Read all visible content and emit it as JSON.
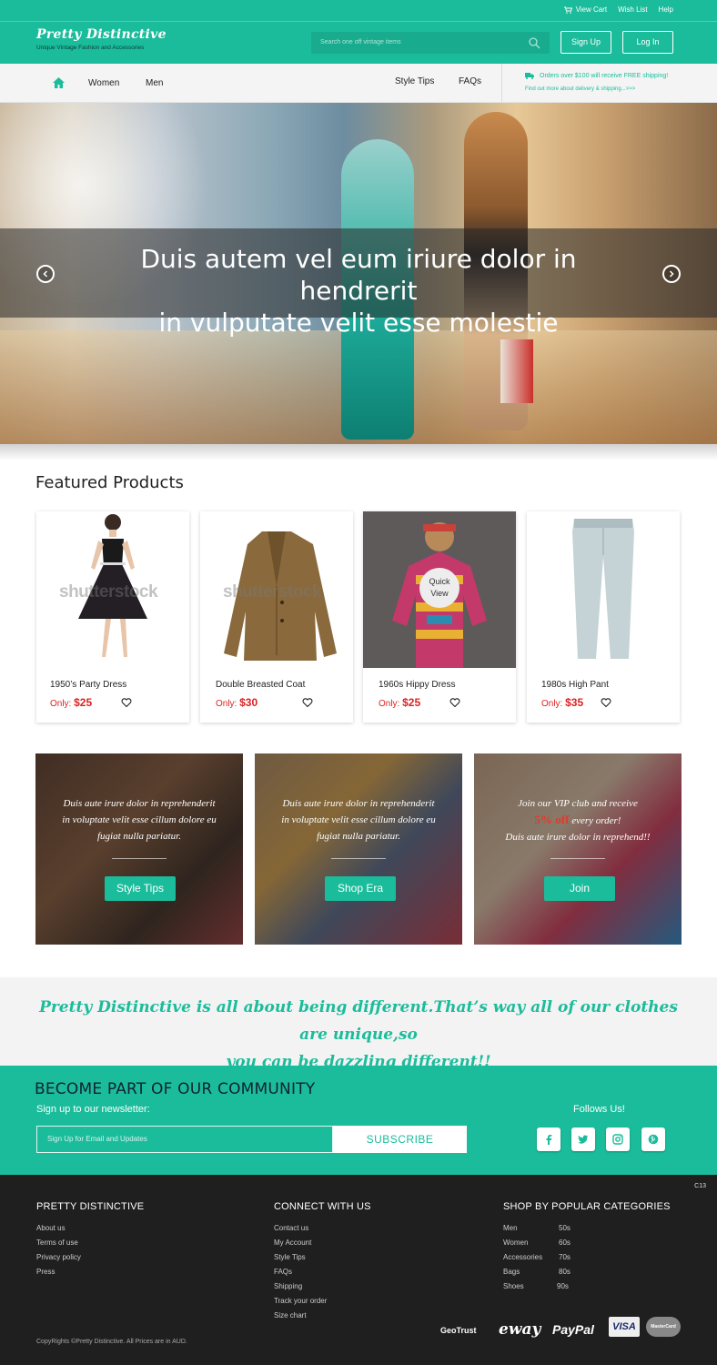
{
  "topbar": {
    "view_cart": "View Cart",
    "wish_list": "Wish List",
    "help": "Help"
  },
  "brand": {
    "name": "Pretty Distinctive",
    "tagline": "Unique Vintage Fashion and Accessories"
  },
  "search": {
    "placeholder": "Search one off  vintage items"
  },
  "auth": {
    "signup": "Sign Up",
    "login": "Log In"
  },
  "nav": {
    "items": [
      "Women",
      "Men",
      "Style Tips",
      "FAQs"
    ],
    "shipping_notice": "Orders over $100 will receive FREE shipping!",
    "shipping_link": "Find out more about delivery & shipping...>>>"
  },
  "hero": {
    "caption_line1": "Duis autem vel eum iriure dolor in hendrerit",
    "caption_line2": "in vulputate velit esse molestie"
  },
  "featured": {
    "title": "Featured Products",
    "watermark": "shutterstock",
    "quick_view": [
      "Quick",
      "View"
    ],
    "products": [
      {
        "name": "1950’s  Party Dress",
        "price_prefix": "Only:",
        "price": "$25"
      },
      {
        "name": "Double Breasted Coat",
        "price_prefix": "Only:",
        "price": "$30"
      },
      {
        "name": "1960s Hippy Dress",
        "price_prefix": "Only:",
        "price": "$25"
      },
      {
        "name": "1980s High Pant",
        "price_prefix": "Only:",
        "price": "$35"
      }
    ]
  },
  "promos": [
    {
      "lines": [
        "Duis aute irure dolor in reprehenderit",
        "in voluptate velit esse cillum dolore eu",
        "fugiat nulla pariatur."
      ],
      "button": "Style Tips"
    },
    {
      "lines": [
        "Duis aute irure dolor in reprehenderit",
        "in voluptate velit esse cillum dolore eu",
        "fugiat nulla pariatur."
      ],
      "button": "Shop Era"
    },
    {
      "line1": "Join our  VIP club and receive",
      "highlight": "5% off",
      "line2_rest": " every order!",
      "line3": "Duis aute irure dolor in reprehend!!",
      "button": "Join"
    }
  ],
  "slogan": {
    "line1": "Pretty Distinctive is all about being different.That’s way all of our clothes are unique,so",
    "line2": "you can be dazzling different!!"
  },
  "community": {
    "heading": "BECOME PART OF OUR COMMUNITY",
    "subheading": "Sign up to our newsletter:",
    "email_placeholder": "Sign Up for Email and Updates",
    "subscribe": "SUBSCRIBE",
    "follow": "Follows Us!",
    "social_icons": [
      "facebook-icon",
      "twitter-icon",
      "instagram-icon",
      "pinterest-icon"
    ]
  },
  "footer": {
    "code": "C13",
    "col1": {
      "heading": "PRETTY DISTINCTIVE",
      "links": [
        "About us",
        "Terms of use",
        "Privacy policy",
        "Press"
      ]
    },
    "col2": {
      "heading": "CONNECT WITH US",
      "links": [
        "Contact us",
        "My Account",
        "Style Tips",
        "FAQs",
        "Shipping",
        "Track your order",
        "Size chart"
      ]
    },
    "col3": {
      "heading": "SHOP BY POPULAR CATEGORIES",
      "left": [
        "Men",
        "Women",
        "Accessories",
        "Bags",
        "Shoes"
      ],
      "right": [
        "50s",
        "60s",
        "70s",
        "80s",
        "90s"
      ]
    },
    "copyright": "CopyRights ©Pretty Distinctive. All Prices are in AUD.",
    "payments": [
      "GeoTrust",
      "eway",
      "PayPal",
      "VISA",
      "MasterCard"
    ]
  },
  "colors": {
    "accent": "#1bbc9b",
    "price": "#dd2222",
    "footer_bg": "#1f1f1f"
  }
}
